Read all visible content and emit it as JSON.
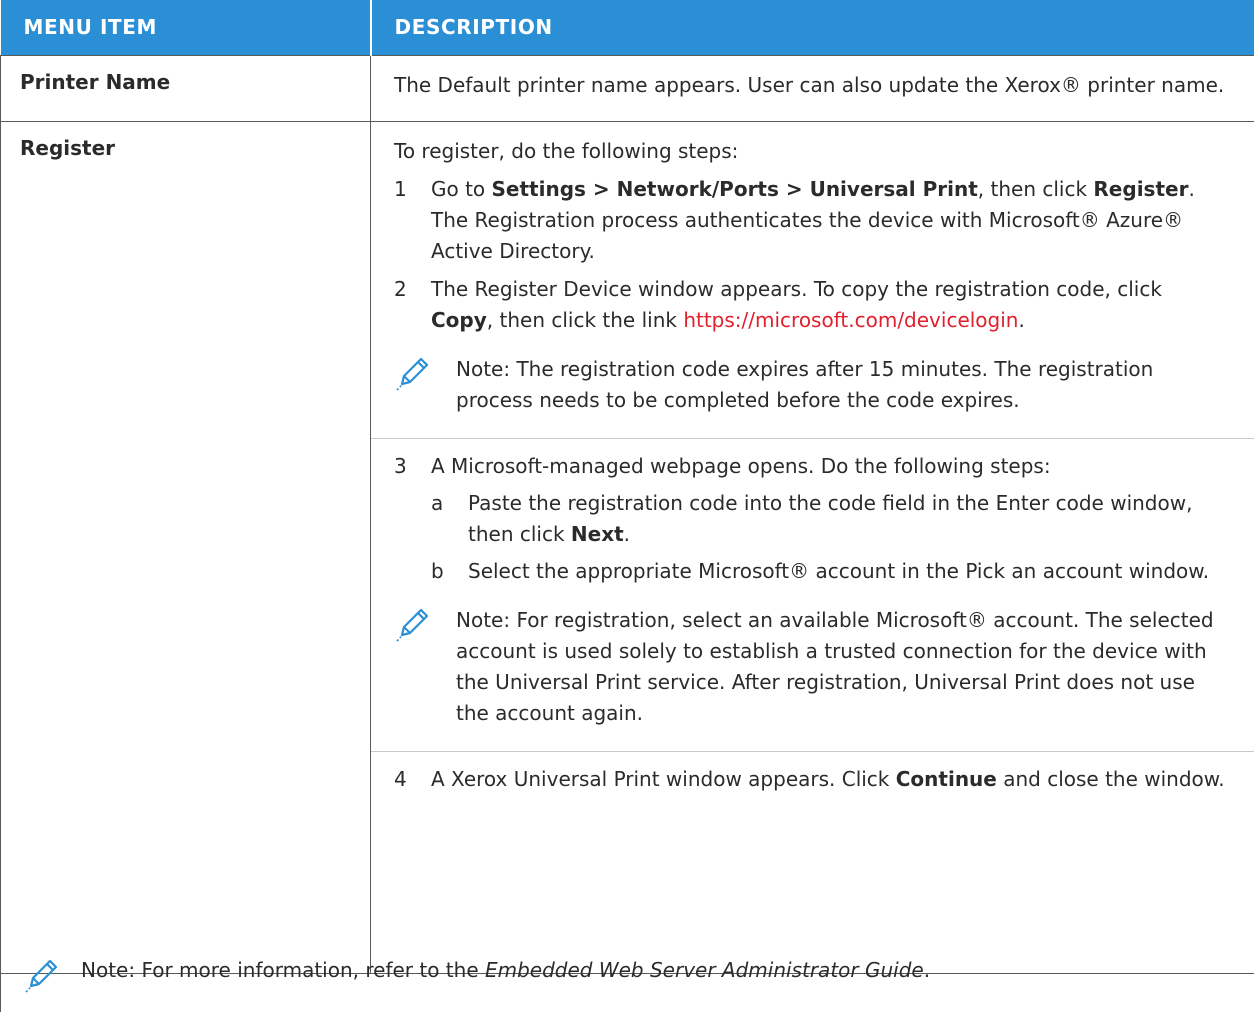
{
  "table": {
    "headers": {
      "col1": "MENU ITEM",
      "col2": "DESCRIPTION"
    },
    "rows": [
      {
        "item": "Printer Name",
        "description": "The Default printer name appears. User can also update the Xerox® printer name."
      },
      {
        "item": "Register",
        "intro": "To register, do the following steps:",
        "steps": {
          "s1": {
            "num": "1",
            "pre": "Go to ",
            "b1": "Settings > Network/Ports > Universal Print",
            "mid": ", then click ",
            "b2": "Register",
            "post": ". The Registration process authenticates the device with Microsoft® Azure® Active Directory."
          },
          "s2": {
            "num": "2",
            "pre": "The Register Device window appears. To copy the registration code, click ",
            "b1": "Copy",
            "mid": ", then click the link ",
            "link": "https://microsoft.com/devicelogin",
            "post": "."
          },
          "note1": "Note: The registration code expires after 15 minutes. The registration process needs to be completed before the code expires.",
          "s3": {
            "num": "3",
            "text": "A Microsoft-managed webpage opens. Do the following steps:",
            "a": {
              "num": "a",
              "pre": "Paste the registration code into the code field in the Enter code window, then click ",
              "b1": "Next",
              "post": "."
            },
            "b": {
              "num": "b",
              "text": "Select the appropriate Microsoft® account in the Pick an account window."
            }
          },
          "note2": "Note: For registration, select an available Microsoft® account. The selected account is used solely to establish a trusted connection for the device with the Universal Print service. After registration, Universal Print does not use the account again.",
          "s4": {
            "num": "4",
            "pre": "A Xerox Universal Print window appears. Click ",
            "b1": "Continue",
            "post": " and close the window."
          }
        }
      }
    ]
  },
  "footer_note": {
    "pre": "Note: For more information, refer to the ",
    "italic": "Embedded Web Server Administrator Guide",
    "post": "."
  },
  "colors": {
    "header_bg": "#2b8fd6",
    "link": "#e0202d",
    "icon": "#2b8fd6"
  },
  "icons": {
    "note": "pencil-icon"
  }
}
